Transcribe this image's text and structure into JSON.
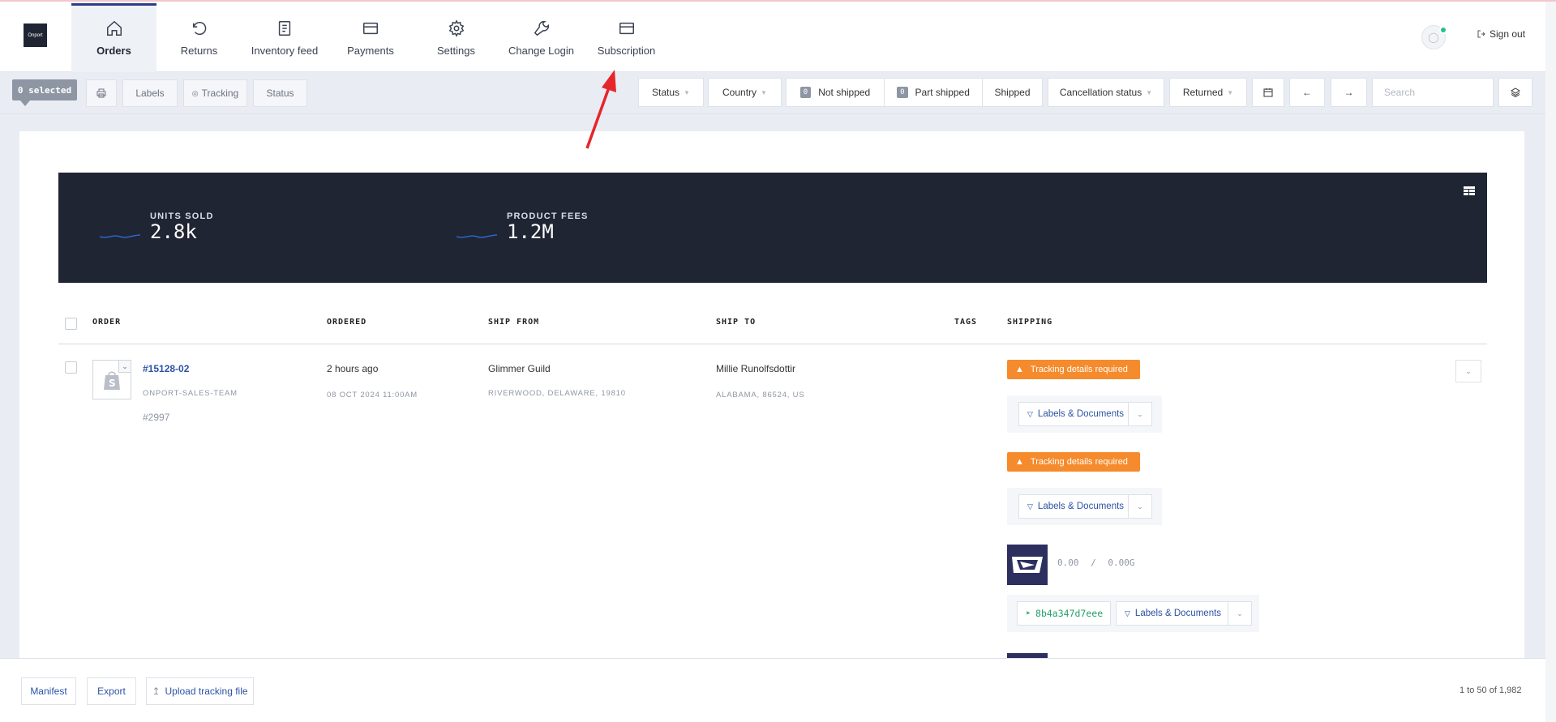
{
  "logo": {
    "text": "Onport"
  },
  "nav": {
    "items": [
      {
        "label": "Orders",
        "icon": "home-icon",
        "active": true
      },
      {
        "label": "Returns",
        "icon": "undo-icon"
      },
      {
        "label": "Inventory feed",
        "icon": "notebook-icon"
      },
      {
        "label": "Payments",
        "icon": "card-icon"
      },
      {
        "label": "Settings",
        "icon": "gear-icon"
      },
      {
        "label": "Change Login",
        "icon": "wrench-icon"
      },
      {
        "label": "Subscription",
        "icon": "card-icon"
      }
    ],
    "sign_out": "Sign out"
  },
  "filters": {
    "selected": "0 selected",
    "labels": "Labels",
    "tracking": "Tracking",
    "status_btn": "Status",
    "status": "Status",
    "country": "Country",
    "not_shipped_count": "0",
    "not_shipped": "Not shipped",
    "part_shipped_count": "0",
    "part_shipped": "Part shipped",
    "shipped": "Shipped",
    "cancellation": "Cancellation status",
    "returned": "Returned",
    "search_placeholder": "Search"
  },
  "stats": {
    "units_label": "UNITS SOLD",
    "units_value": "2.8k",
    "fees_label": "PRODUCT FEES",
    "fees_value": "1.2M"
  },
  "table": {
    "headers": {
      "order": "ORDER",
      "ordered": "ORDERED",
      "ship_from": "SHIP FROM",
      "ship_to": "SHIP TO",
      "tags": "TAGS",
      "shipping": "SHIPPING"
    },
    "row": {
      "order_number": "#15128-02",
      "store": "ONPORT-SALES-TEAM",
      "ref": "#2997",
      "ordered_relative": "2 hours ago",
      "ordered_date": "08 OCT 2024 11:00AM",
      "ship_from_name": "Glimmer Guild",
      "ship_from_address": "RIVERWOOD, DELAWARE, 19810",
      "ship_to_name": "Millie Runolfsdottir",
      "ship_to_address": "ALABAMA, 86524, US",
      "tracking_required": "Tracking details required",
      "labels_docs": "Labels & Documents",
      "weight": "0.00",
      "weight_sep": "/",
      "weight_total": "0.00G",
      "tracking_number": "8b4a347d7eee"
    }
  },
  "footer": {
    "manifest": "Manifest",
    "export": "Export",
    "upload": "Upload tracking file",
    "pagination": "1 to 50 of 1,982"
  },
  "colors": {
    "accent": "#2c52a3",
    "warning": "#f58b2c",
    "dark": "#1f2533",
    "annotation": "#e5262a"
  }
}
